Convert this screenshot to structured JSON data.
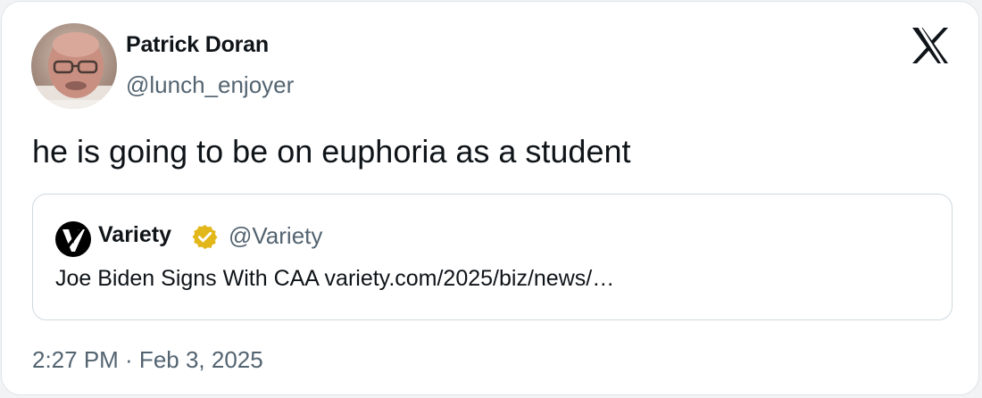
{
  "tweet": {
    "author": {
      "name": "Patrick Doran",
      "handle": "@lunch_enjoyer",
      "avatar_icon": "person-avatar"
    },
    "text": "he is going to be on euphoria as a student",
    "timestamp": "2:27 PM · Feb 3, 2025",
    "platform_icon": "x-logo-icon"
  },
  "quote": {
    "name": "Variety",
    "handle": "@Variety",
    "verified_badge": "gold-verified-badge-icon",
    "logo_icon": "variety-logo-icon",
    "text": "Joe Biden Signs With CAA variety.com/2025/biz/news/…"
  },
  "colors": {
    "text_primary": "#0f1419",
    "text_secondary": "#536471",
    "border": "#cfd9de",
    "badge_gold": "#e2b719"
  }
}
